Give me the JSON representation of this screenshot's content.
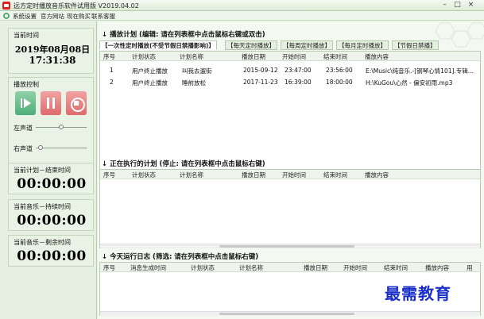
{
  "window": {
    "title": "远方定时播放音乐软件试用版 V2019.04.02",
    "controls": {
      "minimize": "–",
      "maximize": "□",
      "close": "×"
    }
  },
  "menu": {
    "items": [
      "系统设置",
      "官方网站",
      "现在购买",
      "联系客服"
    ]
  },
  "left": {
    "current_time_label": "当前时间",
    "current_date": "2019年08月08日",
    "current_time": "17:31:38",
    "playback_label": "播放控制",
    "left_channel_label": "左声道",
    "right_channel_label": "右声道",
    "left_channel_level": 0.5,
    "right_channel_level": 0.1,
    "plan_end_label": "当前计划－结束时间",
    "plan_end_value": "00:00:00",
    "music_duration_label": "当前音乐－持续时间",
    "music_duration_value": "00:00:00",
    "music_remaining_label": "当前音乐－剩余时间",
    "music_remaining_value": "00:00:00"
  },
  "plan": {
    "title": "播放计划 (编辑: 请在列表框中点击鼠标右键或双击)",
    "tabs": [
      "【一次性定时播放(不受节假日禁播影响)】",
      "【每天定时播放】",
      "【每周定时播放】",
      "【每月定时播放】",
      "【节假日禁播】"
    ],
    "columns": [
      "序号",
      "计划状态",
      "计划名称",
      "播放日期",
      "开始时间",
      "结束时间",
      "播放内容"
    ],
    "rows": [
      [
        "1",
        "用户终止播放",
        "叫我去遛街",
        "2015-09-12",
        "23:47:00",
        "23:56:00",
        "E:\\Music\\纯音乐.-[钢琴心情101].专辑..."
      ],
      [
        "2",
        "用户终止播放",
        "睡前放松",
        "2017-11-23",
        "16:39:00",
        "18:00:00",
        "H:\\KuGou\\心然 - 偏安初雨.mp3"
      ]
    ]
  },
  "running": {
    "title": "正在执行的计划 (停止: 请在列表框中点击鼠标右键)",
    "columns": [
      "序号",
      "计划状态",
      "计划名称",
      "播放日期",
      "开始时间",
      "结束时间",
      "播放内容"
    ]
  },
  "log": {
    "title": "今天运行日志 (筛选: 请在列表框中点击鼠标右键)",
    "columns": [
      "序号",
      "消息生成时间",
      "计划状态",
      "计划名称",
      "播放日期",
      "开始时间",
      "结束时间",
      "播放内容",
      "用"
    ]
  },
  "watermark": "最需教育"
}
